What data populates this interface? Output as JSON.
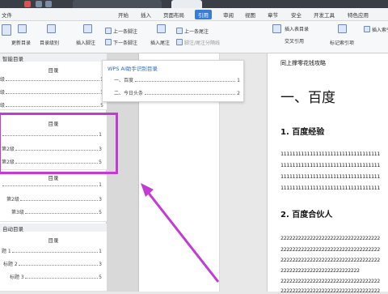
{
  "menubar": {
    "file": "文件",
    "items": [
      "开始",
      "插入",
      "页面布局",
      "引用",
      "审阅",
      "视图",
      "章节",
      "安全",
      "开发工具",
      "特色应用"
    ],
    "active_index": 3
  },
  "ribbon": {
    "update_toc": "更新目录",
    "toc_level": "目录级别",
    "insert_footnote": "插入脚注",
    "prev_footnote": "上一条脚注",
    "next_footnote": "下一条脚注",
    "insert_endnote": "插入尾注",
    "prev_endnote": "上一条尾注",
    "next_endnote": "下一条尾注",
    "convert_note": "脚注/尾注分隔线",
    "insert_caption": "插入表目录",
    "cross_ref": "交叉引用",
    "mark_index": "标记索引项",
    "insert_index": "插入索引"
  },
  "leftpanel": {
    "smart_toc_title": "智能目录",
    "auto_toc_title": "自动目录",
    "boxes": [
      {
        "heading": "目录",
        "lines": [
          {
            "label": "级",
            "page": "1"
          },
          {
            "label": "级",
            "page": "3"
          },
          {
            "label": "级",
            "page": "5"
          }
        ]
      },
      {
        "heading": "目录",
        "lines": [
          {
            "label": "",
            "page": "1"
          },
          {
            "label": "第2级",
            "page": "3"
          },
          {
            "label": "第2级",
            "page": "5"
          }
        ]
      },
      {
        "heading": "目录",
        "lines": [
          {
            "label": "",
            "page": "1"
          },
          {
            "label": "第2级",
            "page": "3"
          },
          {
            "label": "第3级",
            "page": "5"
          }
        ]
      },
      {
        "heading": "目录",
        "lines": [
          {
            "label": "题 1",
            "page": "1"
          },
          {
            "label": "标题 2",
            "page": "3"
          },
          {
            "label": "标题 3",
            "page": "5"
          }
        ]
      }
    ]
  },
  "popup": {
    "title": "WPS AI助手识别目录",
    "items": [
      {
        "label": "一、百度",
        "page": "1"
      },
      {
        "label": "二、今日头条",
        "page": "2"
      }
    ]
  },
  "document": {
    "top_line": "同上撑零花钱攻略",
    "h1": "一、百度",
    "h2a": "1. 百度经验",
    "ones": [
      "1111111111111111111111111111111111",
      "1111111111111111111111111111111111",
      "1111111111111111111111111111111111",
      "1111111111111111111111111111111111"
    ],
    "h2b": "2. 百度合伙人",
    "twos": [
      "2222222222222222222222222222222222",
      "2222222222222222222222222222222222",
      "2222222222222222222222222222222222",
      "222222222222222222222222222",
      "2222222222222222222222222222222222",
      "2222222222222222222222222222222222"
    ]
  },
  "colors": {
    "accent": "#3a7bd5",
    "highlight": "#c23bd4"
  }
}
